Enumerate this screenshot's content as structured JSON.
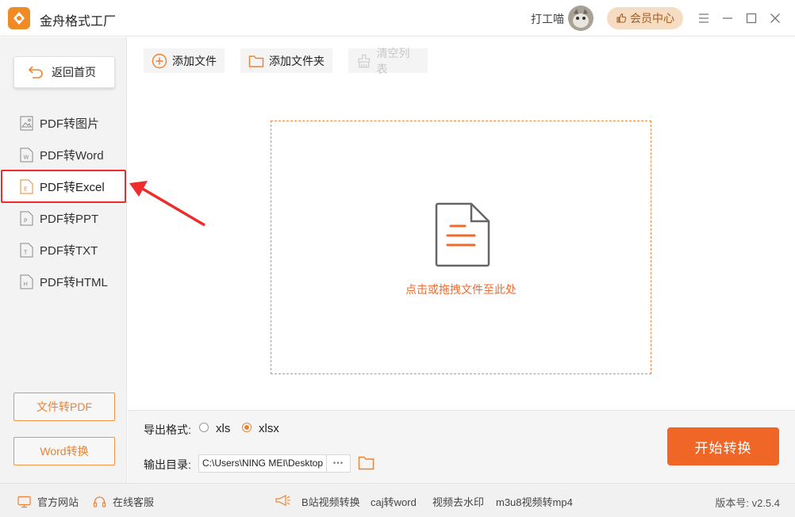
{
  "app": {
    "title": "金舟格式工厂",
    "username": "打工喵",
    "vip_label": "会员中心"
  },
  "sidebar": {
    "back_label": "返回首页",
    "items": [
      {
        "label": "PDF转图片",
        "icon": "image-file-icon"
      },
      {
        "label": "PDF转Word",
        "icon": "word-file-icon"
      },
      {
        "label": "PDF转Excel",
        "icon": "excel-file-icon",
        "active": true
      },
      {
        "label": "PDF转PPT",
        "icon": "ppt-file-icon"
      },
      {
        "label": "PDF转TXT",
        "icon": "txt-file-icon"
      },
      {
        "label": "PDF转HTML",
        "icon": "html-file-icon"
      }
    ],
    "file_to_pdf_label": "文件转PDF",
    "word_convert_label": "Word转换"
  },
  "toolbar": {
    "add_file_label": "添加文件",
    "add_folder_label": "添加文件夹",
    "clear_list_label": "清空列表"
  },
  "dropzone": {
    "hint": "点击或拖拽文件至此处"
  },
  "bottom": {
    "format_label": "导出格式:",
    "format_options": [
      "xls",
      "xlsx"
    ],
    "format_selected": "xlsx",
    "dir_label": "输出目录:",
    "dir_value": "C:\\Users\\NING MEI\\Desktop",
    "dir_more": "•••",
    "start_label": "开始转换"
  },
  "statusbar": {
    "official_site": "官方网站",
    "online_service": "在线客服",
    "links": [
      "B站视频转换",
      "caj转word",
      "视频去水印",
      "m3u8视频转mp4"
    ],
    "version": "版本号: v2.5.4"
  },
  "colors": {
    "accent": "#f06626",
    "highlight": "#ee2c2c"
  }
}
